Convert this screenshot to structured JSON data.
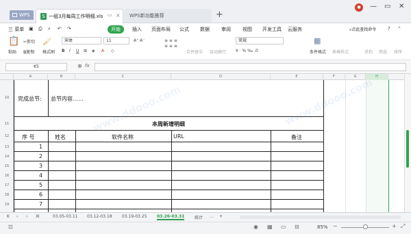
{
  "tabs": {
    "wps": "WPS",
    "doc": "一组3月每周工作明细.xls",
    "recommend": "WPS新功能推荐",
    "new": "+"
  },
  "menu": {
    "items": [
      "三 菜单",
      "开始",
      "插入",
      "页面布局",
      "公式",
      "数据",
      "审阅",
      "视图",
      "开发工具",
      "云服务"
    ],
    "search": "点此查找命令",
    "help": "?"
  },
  "ribbon": {
    "paste": "粘贴",
    "cut": "剪切",
    "copy": "复制",
    "format_painter": "格式刷",
    "font": "宋体",
    "font_size": "11",
    "merge": "合并居中",
    "wrap": "自动换行",
    "number_format": "常规",
    "cond_format": "条件格式",
    "table_style": "表格样式",
    "sum": "求和",
    "filter": "筛选",
    "sort": "排序"
  },
  "formula": {
    "cell_ref": "K5",
    "fx": "fx"
  },
  "columns": [
    "A",
    "B",
    "C",
    "D",
    "E",
    "F",
    "G",
    "H"
  ],
  "row_numbers": [
    "10",
    "11",
    "12",
    "13",
    "14",
    "15",
    "16",
    "17",
    "18",
    "19"
  ],
  "sheet": {
    "summary_label": "完成总节:",
    "summary_content": "总节内容……",
    "section_title": "本周新增明细",
    "headers": [
      "序  号",
      "姓名",
      "软件名称",
      "URL",
      "备注"
    ],
    "seq": [
      "1",
      "2",
      "3",
      "4",
      "5",
      "6",
      "7"
    ]
  },
  "sheet_tabs": [
    "03.05-03.11",
    "03.12-03.18",
    "03.19-03.25",
    "03.26-03.31",
    "统计"
  ],
  "active_sheet": "03.26-03.31",
  "status": {
    "zoom": "85%"
  },
  "accent": "#2ea44f"
}
